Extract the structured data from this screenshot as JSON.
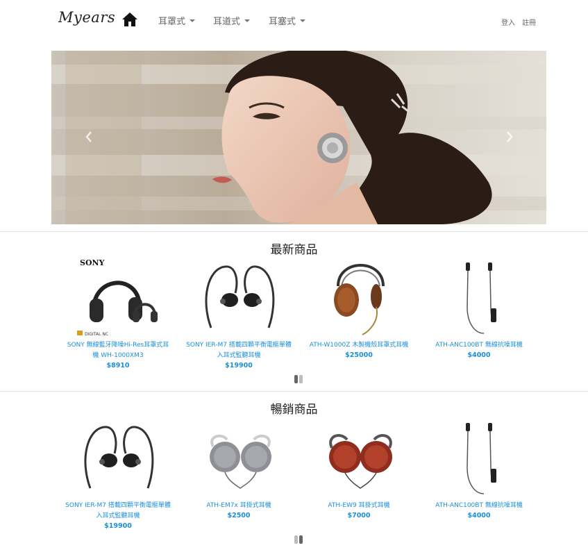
{
  "navbar": {
    "brand": "Myears",
    "menu": [
      {
        "label": "耳罩式"
      },
      {
        "label": "耳道式"
      },
      {
        "label": "耳塞式"
      }
    ],
    "login": "登入",
    "register": "註冊"
  },
  "carousel": {
    "prev_icon": "chevron-left-icon",
    "next_icon": "chevron-right-icon"
  },
  "newest": {
    "title": "最新商品",
    "products": [
      {
        "name": "SONY 無線藍牙降噪Hi-Res耳罩式耳機 WH-1000XM3",
        "price": "$8910",
        "image_label": "SONY",
        "badges": "DIGITAL NC"
      },
      {
        "name": "SONY IER-M7 搭載四顆平衡電樞單體 入耳式監聽耳機",
        "price": "$19900"
      },
      {
        "name": "ATH-W1000Z 木製機殼耳罩式耳機",
        "price": "$25000"
      },
      {
        "name": "ATH-ANC100BT 無線抗噪耳機",
        "price": "$4000"
      }
    ]
  },
  "bestseller": {
    "title": "暢銷商品",
    "products": [
      {
        "name": "SONY IER-M7 搭載四顆平衡電樞單體 入耳式監聽耳機",
        "price": "$19900"
      },
      {
        "name": "ATH-EM7x 耳掛式耳機",
        "price": "$2500"
      },
      {
        "name": "ATH-EW9 耳掛式耳機",
        "price": "$7000"
      },
      {
        "name": "ATH-ANC100BT 無線抗噪耳機",
        "price": "$4000"
      }
    ]
  },
  "colors": {
    "link": "#1a8fd8",
    "text": "#333333"
  }
}
